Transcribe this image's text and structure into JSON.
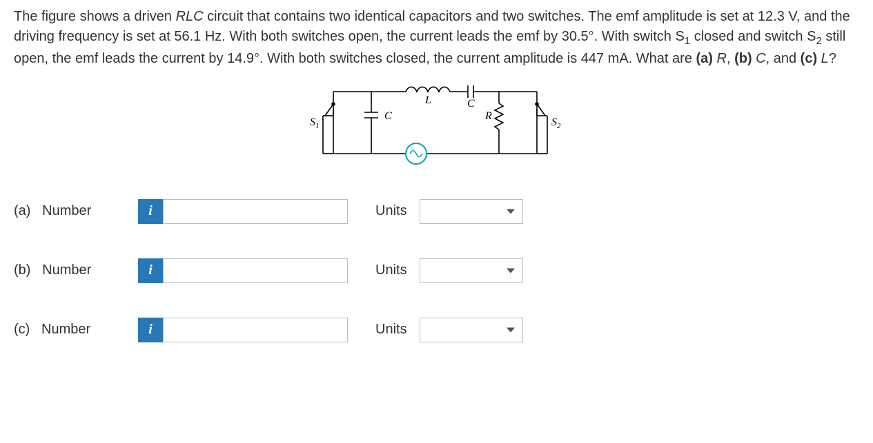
{
  "question": {
    "part1": "The figure shows a driven ",
    "rlc": "RLC",
    "part2": " circuit that contains two identical capacitors and two switches. The emf amplitude is set at 12.3 V, and the driving frequency is set at 56.1 Hz. With both switches open, the current leads the emf by 30.5°. With switch S",
    "s1_sub": "1",
    "part3": " closed and switch S",
    "s2_sub": "2",
    "part4": " still open, the emf leads the current by 14.9°. With both switches closed, the current amplitude is 447 mA. What are ",
    "a": "(a)",
    "r_label": " R",
    "comma1": ", ",
    "b": "(b)",
    "c_label": " C",
    "comma2": ", and ",
    "c": "(c)",
    "l_label": " L",
    "qmark": "?"
  },
  "figure": {
    "S1": "S",
    "S1_sub": "1",
    "C_left": "C",
    "L": "L",
    "C_top": "C",
    "R": "R",
    "S2": "S",
    "S2_sub": "2"
  },
  "answers": {
    "a": {
      "letter": "(a)",
      "label": "Number",
      "units": "Units",
      "info": "i",
      "value": "",
      "placeholder": ""
    },
    "b": {
      "letter": "(b)",
      "label": "Number",
      "units": "Units",
      "info": "i",
      "value": "",
      "placeholder": ""
    },
    "c": {
      "letter": "(c)",
      "label": "Number",
      "units": "Units",
      "info": "i",
      "value": "",
      "placeholder": ""
    }
  }
}
